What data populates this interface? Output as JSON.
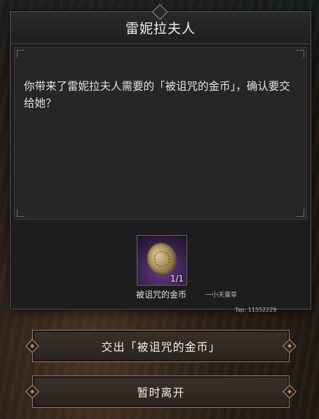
{
  "dialog": {
    "title": "雷妮拉夫人",
    "message": "你带来了雷妮拉夫人需要的「被诅咒的金币」，确认要交给她？"
  },
  "item": {
    "name": "被诅咒的金币",
    "count": "1/1",
    "icon": "cursed-coin-icon"
  },
  "watermark": {
    "name": "一小天粟草",
    "tap": "Tap: 11552229"
  },
  "buttons": {
    "hand_over": "交出「被诅咒的金币」",
    "leave": "暂时离开"
  },
  "colors": {
    "dialog_bg": "#1d1d1f",
    "panel_bg": "#262627",
    "button_border": "#8a7f70",
    "accent": "#d38a50",
    "item_bg": "#6b3a8a"
  }
}
